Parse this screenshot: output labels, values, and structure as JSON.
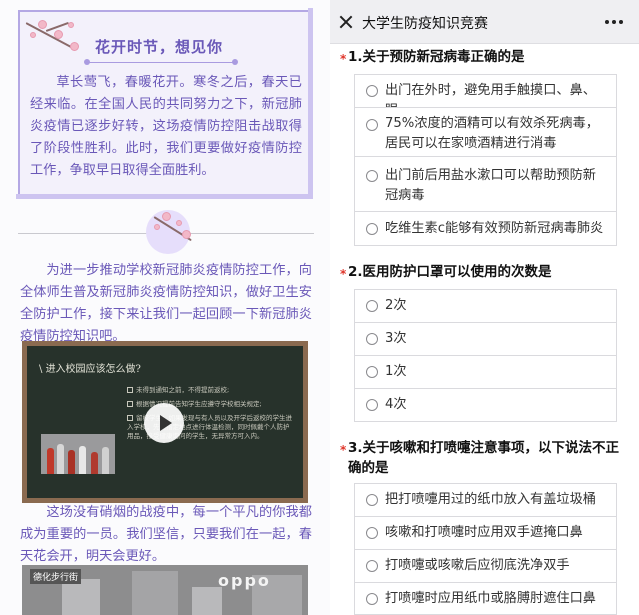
{
  "article": {
    "card_title": "花开时节，想见你",
    "card_text": "草长莺飞，春暖花开。寒冬之后，春天已经来临。在全国人民的共同努力之下，新冠肺炎疫情已逐步好转，这场疫情防控阻击战取得了阶段性胜利。此时，我们更要做好疫情防控工作，争取早日取得全面胜利。",
    "paragraph_1": "为进一步推动学校新冠肺炎疫情防控工作，向全体师生普及新冠肺炎疫情防控知识，做好卫生安全防护工作，接下来让我们一起回顾一下新冠肺炎疫情防控知识吧。",
    "video": {
      "board_title": "进入校园应该怎么做?",
      "board_lines": [
        "未得到通知之前，不得提前返校;",
        "根据情况提前告知学生应遵守学校相关规定;",
        "留校学生：如果发现与有人员以及开学后返校的学生进入学校，先到指定地点进行体温检测，同时佩戴个人防护用品，接受健康询问的学生，无异常方可入内。"
      ],
      "play_icon": "play-icon"
    },
    "paragraph_2": "这场没有硝烟的战疫中，每一个平凡的你我都成为重要的一员。我们坚信，只要我们在一起，春天花会开，明天会更好。",
    "street_sign": "德化步行街",
    "street_logo": "oppo"
  },
  "quiz": {
    "header_title": "大学生防疫知识竞赛",
    "close_icon": "close-icon",
    "more_icon": "more-icon",
    "accent_color": "#e0362b",
    "questions": [
      {
        "required_mark": "*",
        "title": "1.关于预防新冠病毒正确的是",
        "options": [
          "出门在外时，避免用手触摸口、鼻、眼",
          "75%浓度的酒精可以有效杀死病毒，居民可以在家喷酒精进行消毒",
          "出门前后用盐水漱口可以帮助预防新冠病毒",
          "吃维生素c能够有效预防新冠病毒肺炎"
        ]
      },
      {
        "required_mark": "*",
        "title": "2.医用防护口罩可以使用的次数是",
        "options": [
          "2次",
          "3次",
          "1次",
          "4次"
        ]
      },
      {
        "required_mark": "*",
        "title": "3.关于咳嗽和打喷嚏注意事项，以下说法不正确的是",
        "options": [
          "把打喷嚏用过的纸巾放入有盖垃圾桶",
          "咳嗽和打喷嚏时应用双手遮掩口鼻",
          "打喷嚏或咳嗽后应彻底洗净双手",
          "打喷嚏时应用纸巾或胳膊肘遮住口鼻"
        ]
      }
    ]
  }
}
